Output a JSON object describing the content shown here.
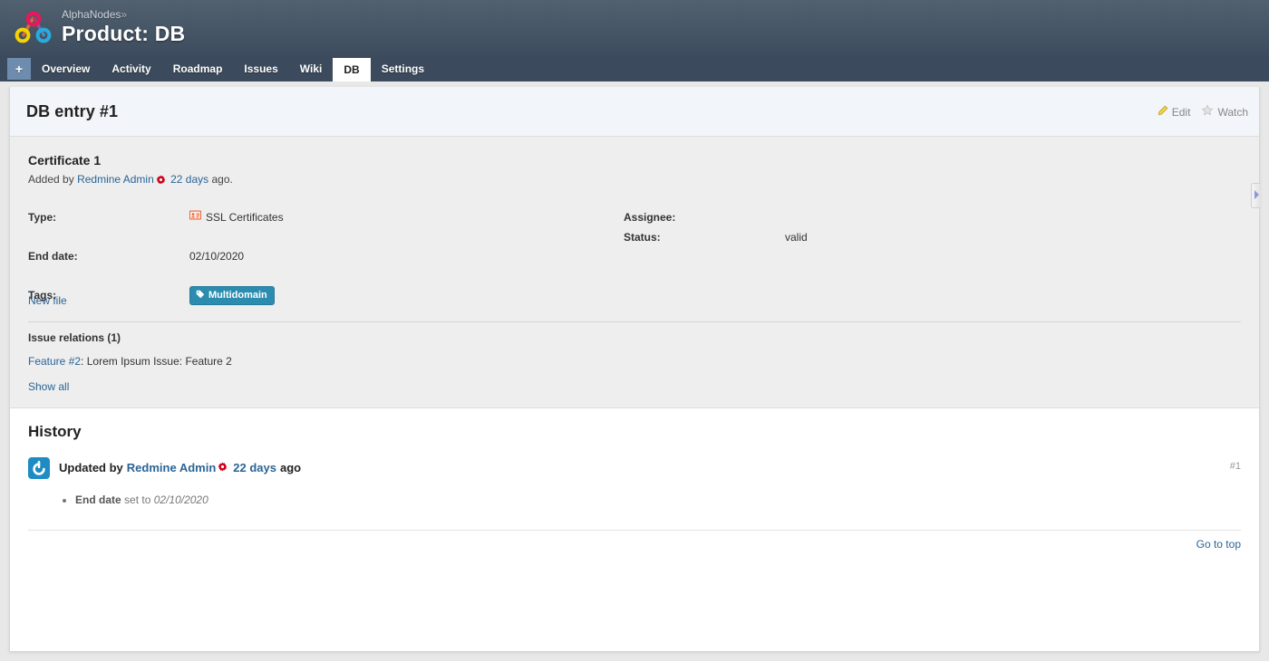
{
  "header": {
    "logo_icon": "alphanodes-logo-icon",
    "project_crumb": "AlphaNodes",
    "crumb_separator": "»",
    "page_title": "Product: DB"
  },
  "main_menu": {
    "add_label": "+",
    "tabs": [
      {
        "label": "Overview",
        "selected": false
      },
      {
        "label": "Activity",
        "selected": false
      },
      {
        "label": "Roadmap",
        "selected": false
      },
      {
        "label": "Issues",
        "selected": false
      },
      {
        "label": "Wiki",
        "selected": false
      },
      {
        "label": "DB",
        "selected": true
      },
      {
        "label": "Settings",
        "selected": false
      }
    ]
  },
  "content_header": {
    "title": "DB entry #1",
    "actions": [
      {
        "label": "Edit",
        "icon": "pencil-icon"
      },
      {
        "label": "Watch",
        "icon": "star-icon"
      }
    ]
  },
  "entry": {
    "title": "Certificate 1",
    "added_prefix": "Added by",
    "author": "Redmine Admin",
    "author_badge_icon": "gear-red-icon",
    "time_ago": "22 days",
    "time_suffix": "ago.",
    "attributes": {
      "type_label": "Type:",
      "type_value": "SSL Certificates",
      "type_icon": "contact-card-icon",
      "assignee_label": "Assignee:",
      "assignee_value": "",
      "end_date_label": "End date:",
      "end_date_value": "02/10/2020",
      "status_label": "Status:",
      "status_value": "valid",
      "tags_label": "Tags:",
      "tags": [
        {
          "label": "Multidomain",
          "icon": "tag-icon",
          "color": "#2b8cb0"
        }
      ]
    },
    "new_file_link": "New file",
    "relations_title": "Issue relations (1)",
    "relations": [
      {
        "link": "Feature #2",
        "separator": ":",
        "text": "Lorem Ipsum Issue: Feature 2"
      }
    ],
    "show_all_link": "Show all"
  },
  "history": {
    "title": "History",
    "entries": [
      {
        "avatar_icon": "gravatar-avatar-icon",
        "updated_prefix": "Updated by",
        "author": "Redmine Admin",
        "author_badge_icon": "gear-red-icon",
        "time_ago": "22 days",
        "time_suffix": "ago",
        "anchor": "#1",
        "details": [
          {
            "field": "End date",
            "action": "set to",
            "value": "02/10/2020"
          }
        ]
      }
    ]
  },
  "footer": {
    "go_to_top": "Go to top"
  },
  "sidebar_toggle": {
    "icon": "chevron-right-icon"
  },
  "colors": {
    "header_top": "#51616f",
    "header_bottom": "#3d4c5e",
    "menu_bar": "#3b4a5c",
    "add_button": "#6e8dae",
    "link": "#2a6496",
    "tag": "#2b8cb0",
    "panel_bg": "#eeeeee",
    "content_header_bg": "#f2f5f9",
    "gear_red": "#d0021b",
    "type_icon_orange": "#e8663a",
    "avatar_blue": "#1e8bc3"
  }
}
